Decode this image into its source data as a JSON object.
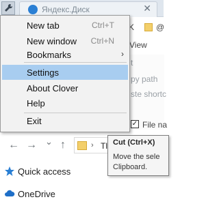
{
  "tab": {
    "title": "Яндекс.Диск",
    "close": "✕"
  },
  "ribbon": {
    "tab_partial": "K",
    "view_label": "View",
    "folder_label": "@",
    "items": [
      "t",
      "py path",
      "ste shortc"
    ],
    "file_name_checkbox": "File na"
  },
  "menu": {
    "items": [
      {
        "label": "New tab",
        "shortcut": "Ctrl+T"
      },
      {
        "label": "New window",
        "shortcut": "Ctrl+N"
      },
      {
        "label": "Bookmarks",
        "arrow": "›"
      },
      {
        "label": "Settings"
      },
      {
        "label": "About Clover"
      },
      {
        "label": "Help"
      },
      {
        "label": "Exit"
      }
    ]
  },
  "nav": {
    "back": "←",
    "forward": "→",
    "dropdown": "⌄",
    "up": "↑",
    "address_text": "Tl",
    "address_chevron": "›"
  },
  "sidebar": {
    "items": [
      {
        "label": "Quick access",
        "icon": "star-icon"
      },
      {
        "label": "OneDrive",
        "icon": "cloud-icon"
      }
    ]
  },
  "tooltip": {
    "title": "Cut (Ctrl+X)",
    "line1": "Move the sele",
    "line2": "Clipboard."
  },
  "colors": {
    "highlight": "#a8cdf0",
    "accent": "#2a7fd4",
    "folder": "#f3cf6b"
  }
}
